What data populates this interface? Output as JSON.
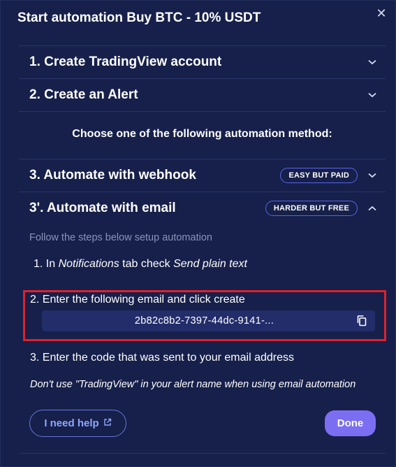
{
  "modal": {
    "title": "Start automation Buy BTC - 10% USDT",
    "close_icon": "close-icon"
  },
  "sections": [
    {
      "label": "1. Create TradingView account",
      "expanded": false
    },
    {
      "label": "2. Create an Alert",
      "expanded": false
    },
    {
      "label": "3. Automate with webhook",
      "badge": "EASY BUT PAID",
      "expanded": false
    },
    {
      "label": "3'. Automate with email",
      "badge": "HARDER BUT FREE",
      "expanded": true
    }
  ],
  "choose_text": "Choose one of the following automation method:",
  "email_section": {
    "intro": "Follow the steps below setup automation",
    "step1": {
      "prefix": "1. In ",
      "tab": "Notifications",
      "middle": " tab check ",
      "option": "Send plain text"
    },
    "step2": "2. Enter the following email and click create",
    "email_value": "2b82c8b2-7397-44dc-9141-...",
    "step3": "3. Enter the code that was sent to your email address",
    "warning": "Don't use \"TradingView\" in your alert name when using email automation"
  },
  "footer": {
    "help_label": "I need help",
    "done_label": "Done"
  },
  "colors": {
    "background": "#16204a",
    "accent": "#7b6ef2",
    "badge_border": "#5a63e8",
    "highlight": "#e0202a"
  }
}
